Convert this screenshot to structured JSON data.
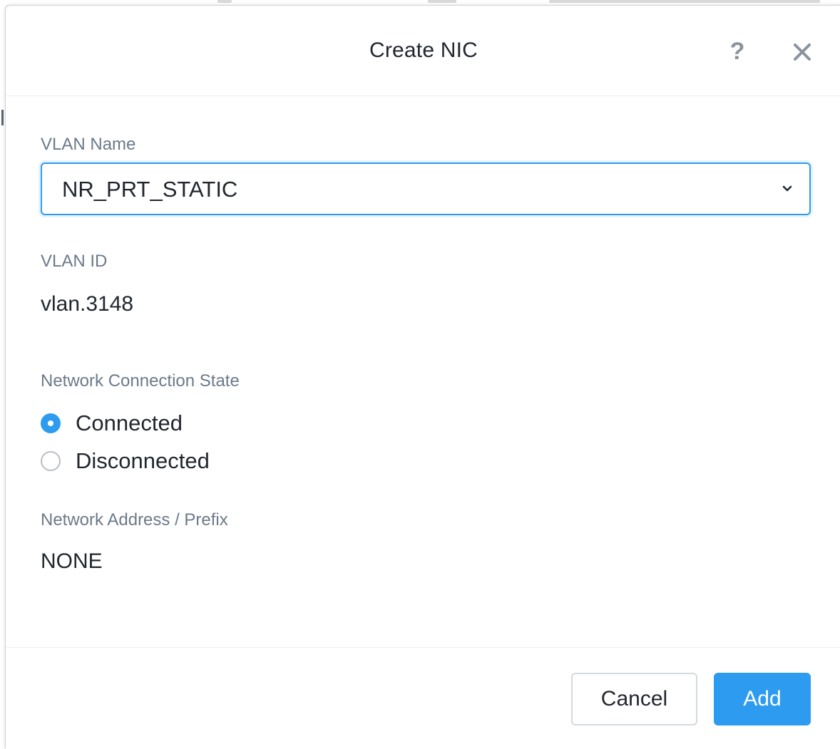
{
  "dialog": {
    "title": "Create NIC",
    "help_glyph": "?"
  },
  "vlan_name": {
    "label": "VLAN Name",
    "selected": "NR_PRT_STATIC"
  },
  "vlan_id": {
    "label": "VLAN ID",
    "value": "vlan.3148"
  },
  "connection_state": {
    "label": "Network Connection State",
    "options": [
      {
        "label": "Connected",
        "selected": true
      },
      {
        "label": "Disconnected",
        "selected": false
      }
    ]
  },
  "network_address": {
    "label": "Network Address / Prefix",
    "value": "NONE"
  },
  "footer": {
    "cancel_label": "Cancel",
    "add_label": "Add"
  },
  "colors": {
    "accent": "#2d9cf0",
    "label": "#6c7a89",
    "text": "#22272e",
    "icon": "#8a939e"
  },
  "icons": {
    "help": "question-mark-icon",
    "close": "close-icon",
    "dropdown": "chevron-down-icon"
  }
}
